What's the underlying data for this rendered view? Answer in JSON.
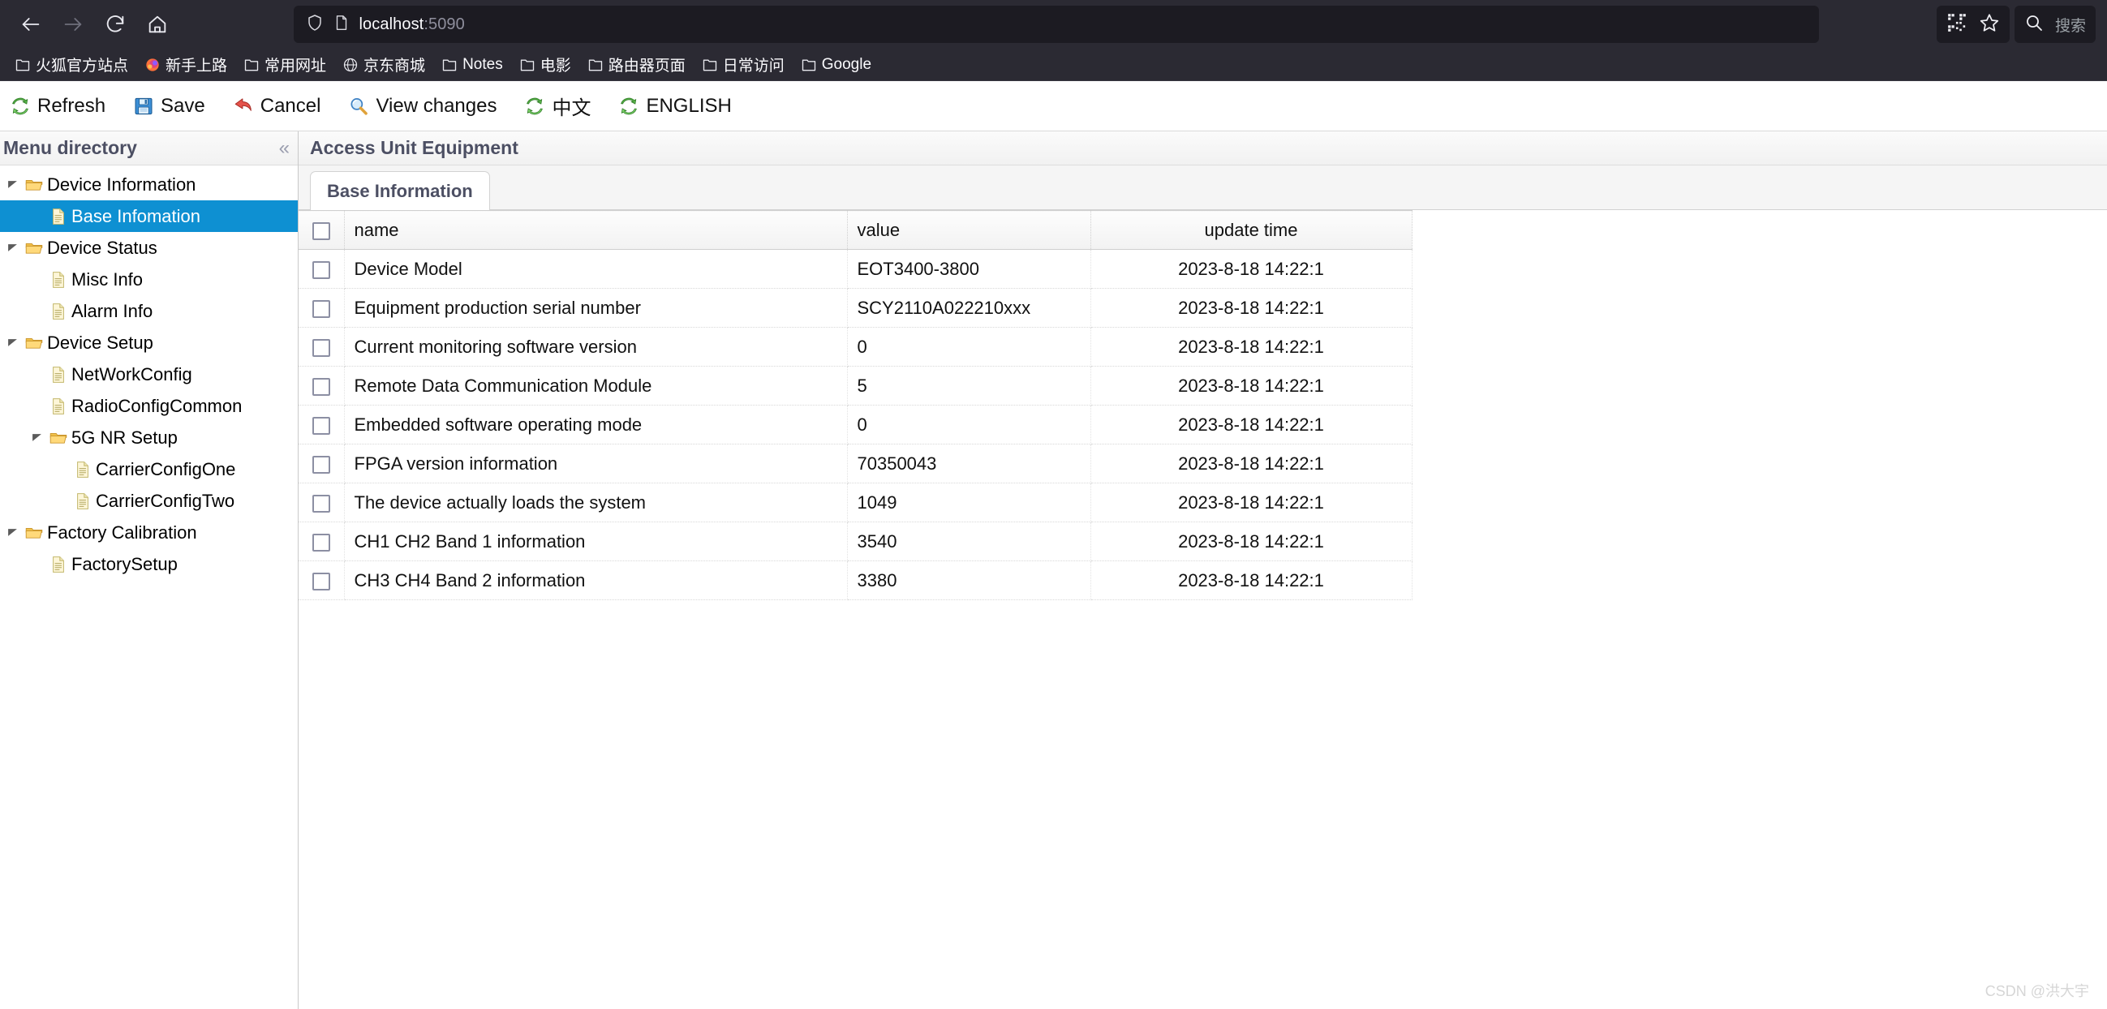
{
  "browser": {
    "nav": {
      "back": "back-arrow",
      "forward": "forward-arrow",
      "reload": "reload",
      "home": "home"
    },
    "url": {
      "host": "localhost",
      "port": ":5090",
      "shield_icon": "shield-icon",
      "page_icon": "page-icon"
    },
    "right": {
      "qr_icon": "qr-code-icon",
      "bookmark_icon": "star-icon",
      "search_icon": "search-icon",
      "search_label": "搜索"
    },
    "bookmarks": [
      {
        "label": "火狐官方站点",
        "icon": "folder-icon"
      },
      {
        "label": "新手上路",
        "icon": "firefox-icon"
      },
      {
        "label": "常用网址",
        "icon": "folder-icon"
      },
      {
        "label": "京东商城",
        "icon": "globe-icon"
      },
      {
        "label": "Notes",
        "icon": "folder-icon"
      },
      {
        "label": "电影",
        "icon": "folder-icon"
      },
      {
        "label": "路由器页面",
        "icon": "folder-icon"
      },
      {
        "label": "日常访问",
        "icon": "folder-icon"
      },
      {
        "label": "Google",
        "icon": "folder-icon"
      }
    ]
  },
  "toolbar": {
    "items": [
      {
        "label": "Refresh",
        "icon": "refresh-icon"
      },
      {
        "label": "Save",
        "icon": "save-disk-icon"
      },
      {
        "label": "Cancel",
        "icon": "undo-arrow-icon"
      },
      {
        "label": "View changes",
        "icon": "magnifier-icon"
      },
      {
        "label": "中文",
        "icon": "refresh-icon"
      },
      {
        "label": "ENGLISH",
        "icon": "refresh-icon"
      }
    ]
  },
  "sidebar": {
    "title": "Menu directory",
    "collapse_icon": "chevron-double-left-icon",
    "tree": [
      {
        "label": "Device Information",
        "level": 1,
        "type": "folder",
        "expanded": true,
        "selected": false
      },
      {
        "label": "Base Infomation",
        "level": 2,
        "type": "file",
        "expanded": false,
        "selected": true
      },
      {
        "label": "Device Status",
        "level": 1,
        "type": "folder",
        "expanded": true,
        "selected": false
      },
      {
        "label": "Misc Info",
        "level": 2,
        "type": "file",
        "expanded": false,
        "selected": false
      },
      {
        "label": "Alarm Info",
        "level": 2,
        "type": "file",
        "expanded": false,
        "selected": false
      },
      {
        "label": "Device Setup",
        "level": 1,
        "type": "folder",
        "expanded": true,
        "selected": false
      },
      {
        "label": "NetWorkConfig",
        "level": 2,
        "type": "file",
        "expanded": false,
        "selected": false
      },
      {
        "label": "RadioConfigCommon",
        "level": 2,
        "type": "file",
        "expanded": false,
        "selected": false
      },
      {
        "label": "5G NR Setup",
        "level": 3,
        "type": "folder",
        "expanded": true,
        "selected": false
      },
      {
        "label": "CarrierConfigOne",
        "level": 4,
        "type": "file",
        "expanded": false,
        "selected": false
      },
      {
        "label": "CarrierConfigTwo",
        "level": 4,
        "type": "file",
        "expanded": false,
        "selected": false
      },
      {
        "label": "Factory Calibration",
        "level": 1,
        "type": "folder",
        "expanded": true,
        "selected": false
      },
      {
        "label": "FactorySetup",
        "level": 2,
        "type": "file",
        "expanded": false,
        "selected": false
      }
    ]
  },
  "content": {
    "page_title": "Access Unit Equipment",
    "tabs": [
      {
        "label": "Base Information",
        "active": true
      }
    ],
    "table": {
      "columns": [
        "name",
        "value",
        "update time"
      ],
      "rows": [
        {
          "checked": false,
          "name": "Device Model",
          "value": "EOT3400-3800",
          "update_time": "2023-8-18 14:22:1"
        },
        {
          "checked": false,
          "name": "Equipment production serial number",
          "value": "SCY2110A022210xxx",
          "update_time": "2023-8-18 14:22:1"
        },
        {
          "checked": false,
          "name": "Current monitoring software version",
          "value": "0",
          "update_time": "2023-8-18 14:22:1"
        },
        {
          "checked": false,
          "name": "Remote Data Communication Module",
          "value": "5",
          "update_time": "2023-8-18 14:22:1"
        },
        {
          "checked": false,
          "name": "Embedded software operating mode",
          "value": "0",
          "update_time": "2023-8-18 14:22:1"
        },
        {
          "checked": false,
          "name": "FPGA version information",
          "value": "70350043",
          "update_time": "2023-8-18 14:22:1"
        },
        {
          "checked": false,
          "name": "The device actually loads the system",
          "value": "1049",
          "update_time": "2023-8-18 14:22:1"
        },
        {
          "checked": false,
          "name": "CH1 CH2 Band 1 information",
          "value": "3540",
          "update_time": "2023-8-18 14:22:1"
        },
        {
          "checked": false,
          "name": "CH3 CH4 Band 2 information",
          "value": "3380",
          "update_time": "2023-8-18 14:22:1"
        }
      ]
    }
  },
  "watermark": "CSDN @洪大宇",
  "colors": {
    "chrome_bg": "#2b2a33",
    "urlbar_bg": "#1c1b22",
    "selection_blue": "#0e90d2",
    "header_text": "#4c4f63",
    "folder_yellow": "#f5cf6b"
  }
}
